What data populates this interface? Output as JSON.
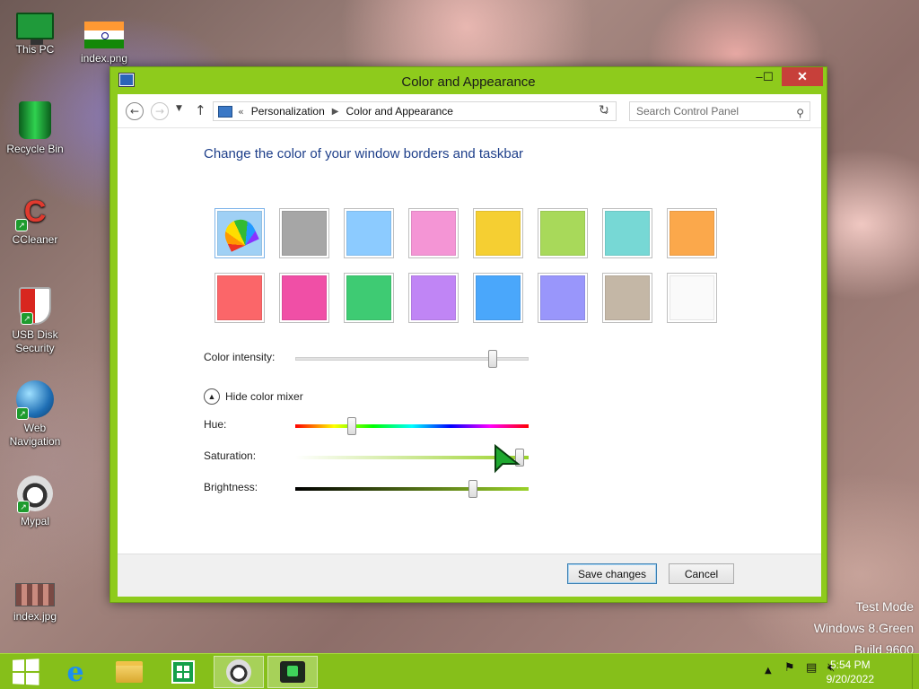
{
  "desktop": {
    "icons": [
      {
        "label": "This PC"
      },
      {
        "label": "index.png"
      },
      {
        "label": "Recycle Bin"
      },
      {
        "label": "CCleaner"
      },
      {
        "label": "USB Disk\nSecurity"
      },
      {
        "label": "Web\nNavigation"
      },
      {
        "label": "Mypal"
      },
      {
        "label": "index.jpg"
      }
    ]
  },
  "window": {
    "title": "Color and Appearance",
    "accent_color": "#8ecb1c",
    "close_glyph": "✕",
    "minimize_glyph": "–",
    "maximize_glyph": "☐"
  },
  "address_bar": {
    "chevron": "«",
    "breadcrumbs": [
      "Personalization",
      "Color and Appearance"
    ],
    "search_placeholder": "Search Control Panel"
  },
  "content": {
    "heading": "Change the color of your window borders and taskbar",
    "swatches": [
      {
        "color": "automatic",
        "selected": true
      },
      {
        "color": "#a6a6a6"
      },
      {
        "color": "#8ccbff"
      },
      {
        "color": "#f495d5"
      },
      {
        "color": "#f5cf32"
      },
      {
        "color": "#a8d95a"
      },
      {
        "color": "#77d8d5"
      },
      {
        "color": "#fba84b"
      },
      {
        "color": "#fb6669"
      },
      {
        "color": "#f04fa6"
      },
      {
        "color": "#3ecb73"
      },
      {
        "color": "#c085f5"
      },
      {
        "color": "#4aa7fb"
      },
      {
        "color": "#9996fb"
      },
      {
        "color": "#c4b7a6"
      },
      {
        "color": "#fafafa"
      }
    ],
    "color_intensity": {
      "label": "Color intensity:",
      "value": 0.86
    },
    "mixer_toggle": "Hide color mixer",
    "hue": {
      "label": "Hue:",
      "value": 0.23
    },
    "saturation": {
      "label": "Saturation:",
      "value": 0.98
    },
    "brightness": {
      "label": "Brightness:",
      "value": 0.77
    }
  },
  "footer": {
    "save_label": "Save changes",
    "cancel_label": "Cancel"
  },
  "watermark": {
    "line1": "Test Mode",
    "line2": "Windows 8.Green",
    "line3": "Build 9600"
  },
  "taskbar": {
    "time": "5:54 PM",
    "date": "9/20/2022"
  }
}
